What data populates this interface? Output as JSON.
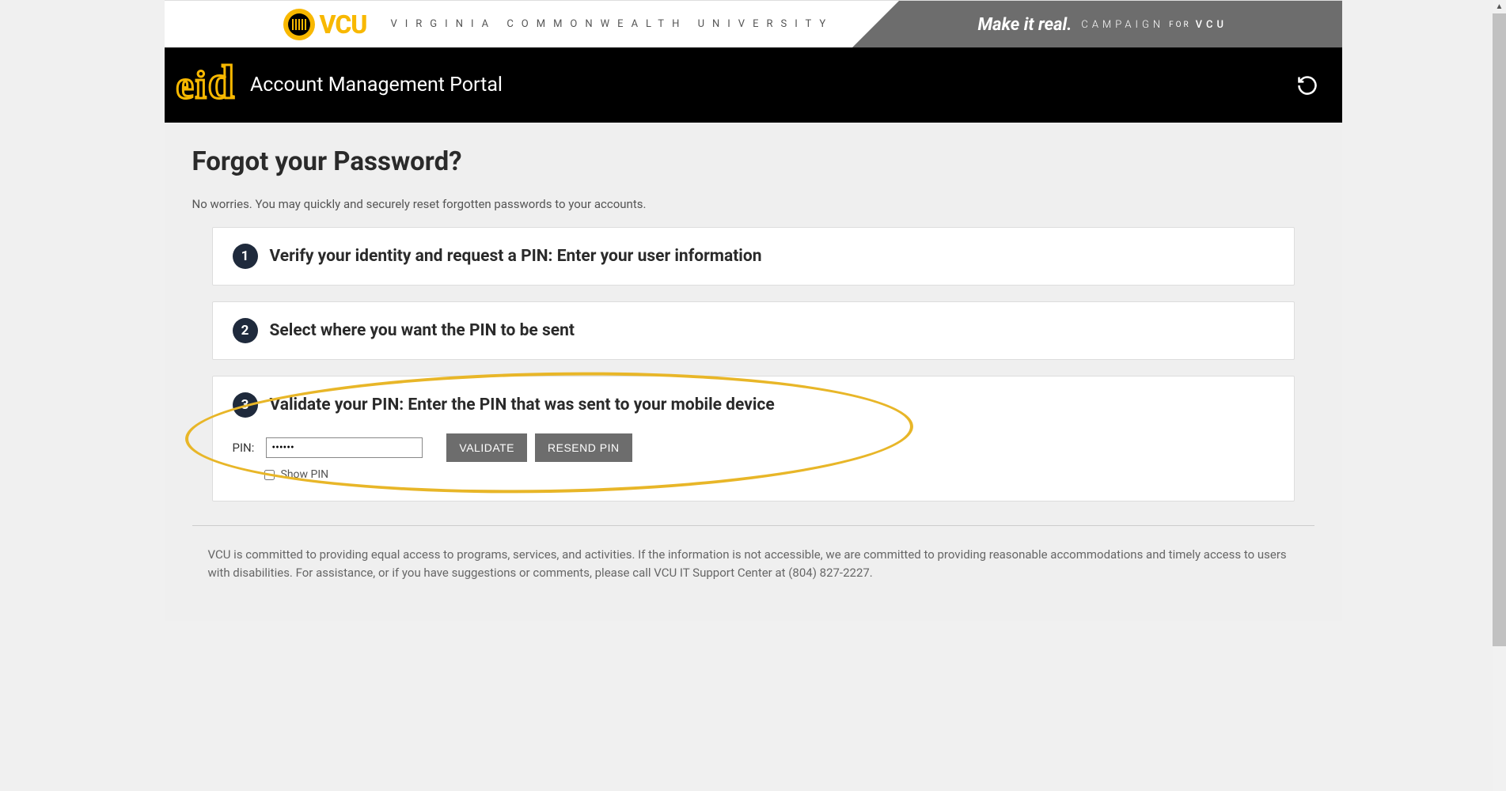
{
  "brand": {
    "logo_text": "VCU",
    "full_name": "VIRGINIA COMMONWEALTH UNIVERSITY"
  },
  "campaign": {
    "tagline": "Make it real.",
    "label": "CAMPAIGN",
    "for": "FOR",
    "vcu": "VCU"
  },
  "portal": {
    "title": "Account Management Portal"
  },
  "page": {
    "title": "Forgot your Password?",
    "subtitle": "No worries. You may quickly and securely reset forgotten passwords to your accounts."
  },
  "steps": [
    {
      "num": "1",
      "title": "Verify your identity and request a PIN: Enter your user information"
    },
    {
      "num": "2",
      "title": "Select where you want the PIN to be sent"
    },
    {
      "num": "3",
      "title": "Validate your PIN: Enter the PIN that was sent to your mobile device"
    }
  ],
  "form": {
    "pin_label": "PIN:",
    "pin_value": "••••••",
    "validate_label": "VALIDATE",
    "resend_label": "RESEND PIN",
    "show_pin_label": "Show PIN"
  },
  "footer": {
    "text": "VCU is committed to providing equal access to programs, services, and activities. If the information is not accessible, we are committed to providing reasonable accommodations and timely access to users with disabilities. For assistance, or if you have suggestions or comments, please call VCU IT Support Center at (804) 827-2227."
  }
}
